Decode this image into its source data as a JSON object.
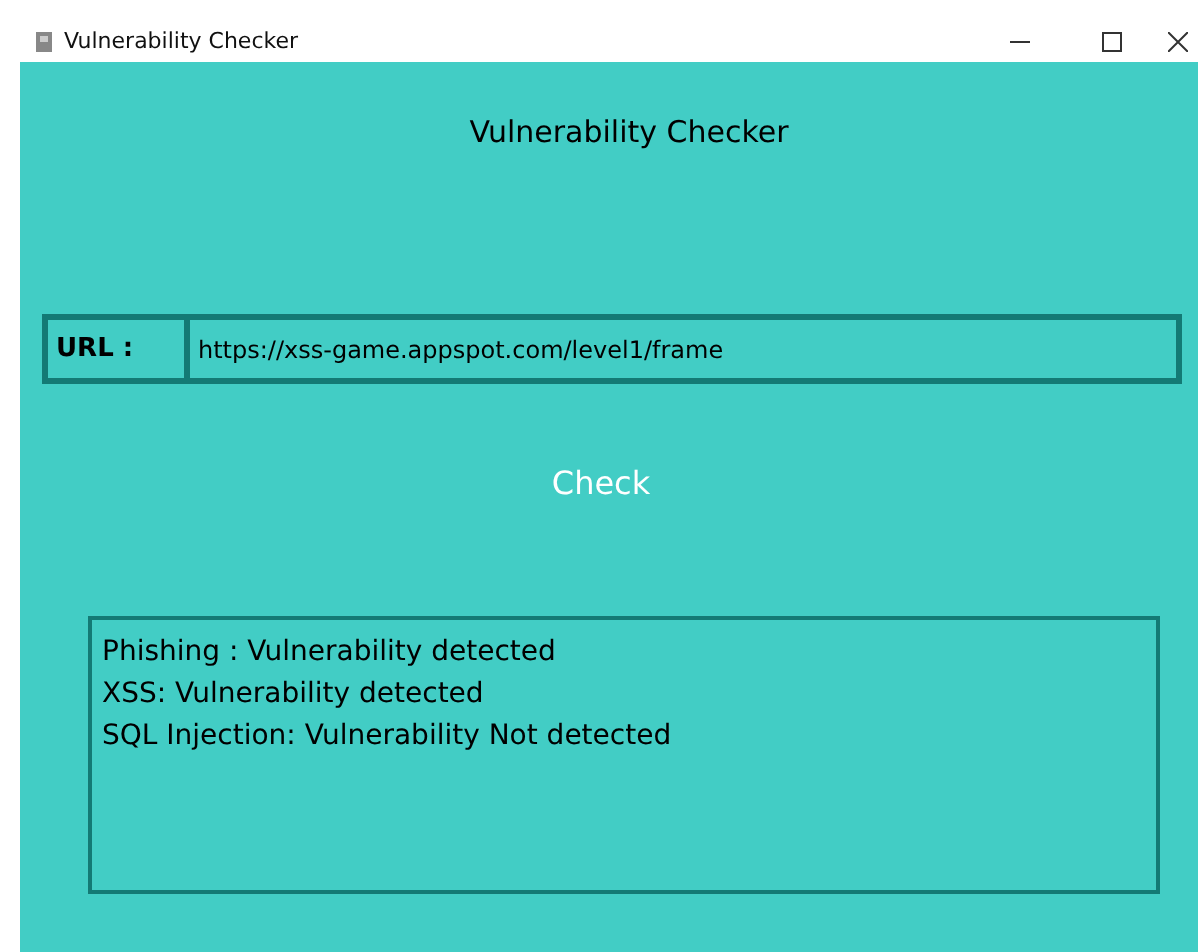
{
  "window": {
    "title": "Vulnerability Checker"
  },
  "heading": "Vulnerability Checker",
  "url_field": {
    "label": "URL :",
    "value": "https://xss-game.appspot.com/level1/frame"
  },
  "check_button": "Check",
  "results": [
    "Phishing : Vulnerability detected",
    "XSS: Vulnerability detected",
    "SQL Injection: Vulnerability Not detected"
  ]
}
